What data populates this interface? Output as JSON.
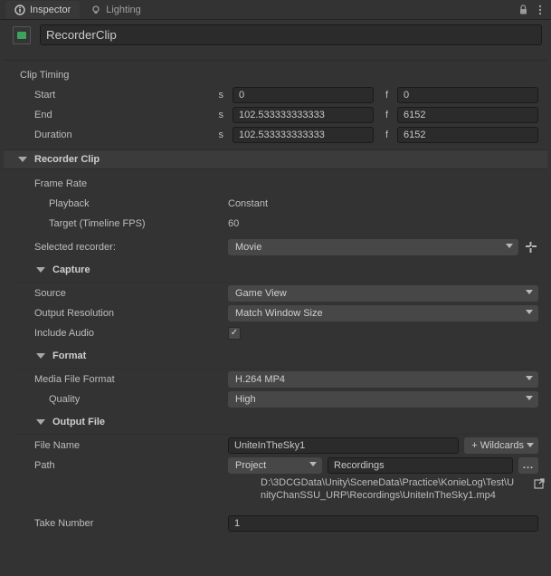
{
  "tabs": {
    "inspector": "Inspector",
    "lighting": "Lighting"
  },
  "asset": {
    "name": "RecorderClip"
  },
  "clipTiming": {
    "title": "Clip Timing",
    "start_label": "Start",
    "start_s": "0",
    "start_f": "0",
    "end_label": "End",
    "end_s": "102.533333333333",
    "end_f": "6152",
    "duration_label": "Duration",
    "duration_s": "102.533333333333",
    "duration_f": "6152",
    "unit_s": "s",
    "unit_f": "f"
  },
  "component": {
    "title": "Recorder Clip"
  },
  "frameRate": {
    "title": "Frame Rate",
    "playback_label": "Playback",
    "playback_value": "Constant",
    "target_label": "Target (Timeline FPS)",
    "target_value": "60"
  },
  "selectedRecorder": {
    "label": "Selected recorder:",
    "value": "Movie"
  },
  "capture": {
    "title": "Capture",
    "source_label": "Source",
    "source_value": "Game View",
    "resolution_label": "Output Resolution",
    "resolution_value": "Match Window Size",
    "audio_label": "Include Audio",
    "audio_checked": true
  },
  "format": {
    "title": "Format",
    "media_label": "Media File Format",
    "media_value": "H.264 MP4",
    "quality_label": "Quality",
    "quality_value": "High"
  },
  "outputFile": {
    "title": "Output File",
    "filename_label": "File Name",
    "filename_value": "UniteInTheSky1",
    "wildcards_label": "+ Wildcards",
    "path_label": "Path",
    "path_root": "Project",
    "path_leaf": "Recordings",
    "browse_label": "...",
    "full_path": "D:\\3DCGData\\Unity\\SceneData\\Practice\\KonieLog\\Test\\UnityChanSSU_URP\\Recordings\\UniteInTheSky1.mp4",
    "take_label": "Take Number",
    "take_value": "1"
  }
}
